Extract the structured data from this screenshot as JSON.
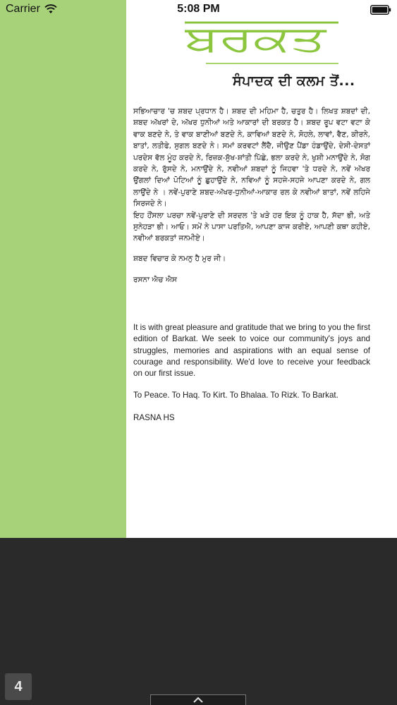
{
  "status_bar": {
    "carrier": "Carrier",
    "time": "5:08 PM"
  },
  "magazine": {
    "masthead": "ਬਰਕਤ",
    "subtitle": "ਸੰਪਾਦਕ ਦੀ ਕਲਮ ਤੋਂ...",
    "punjabi_paragraphs": [
      "ਸਭਿਆਚਾਰ 'ਚ ਸ਼ਬਦ ਪ੍ਰਧਾਨ ਹੈ। ਸ਼ਬਦ ਦੀ ਮਹਿਮਾ ਹੈ, ਚਤੁਰ ਹੈ। ਲਿਖਤ ਸ਼ਬਦਾਂ ਦੀ, ਸ਼ਬਦ ਅੱਖਰਾਂ ਦੇ, ਅੱਖਰ ਧੁਨੀਆਂ ਅਤੇ ਆਕਾਰਾਂ ਦੀ ਬਰਕਤ ਹੈ। ਸ਼ਬਦ ਰੂਪ ਵਟਾ ਵਟਾ ਕੇ ਵਾਕ ਬਣਦੇ ਨੇ, ਤੇ ਵਾਕ ਬਾਣੀਆਂ ਬਣਦੇ ਨੇ, ਕਾਵਿਆਂ ਬਣਦੇ ਨੇ, ਸੋਹਲੇ, ਲਾਵਾਂ, ਵੈਣ, ਕੀਰਨੇ, ਬਾਤਾਂ, ਲਤੀਫੇ, ਸੁਗਲ ਬਣਦੇ ਨੇ। ਸਮਾਂ ਕਰਵਟਾਂ ਲੈਂਦੈ, ਜੀਉਣ ਪੈਂਡਾ ਹੰਡਾਉਂਦੇ, ਦੇਸੀ-ਦੇਸਤਾਂ ਪਰਦੇਸ ਵੱਲ ਮੂੰਹ ਕਰਦੇ ਨੇ, ਰਿਜ਼ਕ-ਸੁੱਖ-ਸ਼ਾਂਤੀ ਪਿੱਛੇ, ਭਲਾ ਕਰਦੇ ਨੇ, ਖੁਸ਼ੀ ਮਨਾਉਂਦੇ ਨੇ, ਸੋਗ ਕਰਦੇ ਨੇ, ਰੁੱਸਦੇ ਨੇ, ਮਨਾਉਂਦੇ ਨੇ, ਨਵੀਆਂ ਸ਼ਬਦਾਂ ਨੂੰ ਜਿਹਵਾ 'ਤੇ ਧਰਦੇ ਨੇ, ਨਵੇਂ ਅੱਖਰ ਉਂਗਲਾਂ ਦਿਆਂ ਪੋਟਿਆਂ ਨੂੰ ਛੁਹਾਉਂਦੇ ਨੇ, ਨਵਿਆਂ ਨੂੰ ਸਹਜੇ-ਸਹਜੇ ਆਪਣਾ ਕਰਦੇ ਨੇ, ਗਲ ਲਾਉਂਦੇ ਨੇ । ਨਵੇਂ-ਪੁਰਾਣੇ ਸ਼ਬਦ-ਅੱਖਰ-ਧੁਨੀਆਂ-ਆਕਾਰ ਰਲ ਕੇ ਨਵੀਆਂ ਬਾਤਾਂ, ਨਵੇਂ ਲਹਿਜੇ ਸਿਰਜਦੇ ਨੇ।",
      "ਇਹ ਹੌਂਸਲਾ ਪਰਚਾ ਨਵੇਂ-ਪੁਰਾਣੇ ਦੀ ਸਰਦਲ 'ਤੇ ਖੜੇ ਹਰ ਇਕ ਨੂੰ ਹਾਕ ਹੈ, ਸੱਦਾ ਭੀ, ਅਤੇ ਸੁਨੇਹੜਾ ਭੀ। ਆਓ। ਸਮੇਂ ਨੇ ਪਾਸਾ ਪਰਤਿਐ, ਆਪਣਾ ਕਾਜ ਕਰੀਏ, ਆਪਣੀ ਕਥਾ ਕਹੀਏ, ਨਵੀਆਂ ਬਰਕਤਾਂ ਜਨਮੀਏ।",
      "ਸ਼ਬਦ ਵਿਚਾਰ ਕੇ ਨਮਨੁ ਹੈ ਮੁਰ ਜੀ।",
      "ਰਸਨਾ ਐਚ ਐਸ"
    ],
    "english_paragraphs": [
      "It is with great pleasure and gratitude that we bring to you the first edition of Barkat. We seek to voice our community's joys and struggles, memories and aspirations with an equal sense of courage and responsibility. We'd love to receive your feedback on our first issue.",
      "To Peace. To Haq. To Kirt. To Bhalaa. To Rizk. To Barkat.",
      "RASNA HS"
    ]
  },
  "controls": {
    "page_number": "4",
    "handle_icon": "chevron-up-icon"
  },
  "colors": {
    "accent_green": "#a8d27a",
    "masthead_green": "#8cc63f",
    "dark_background": "#2a2a2a"
  }
}
